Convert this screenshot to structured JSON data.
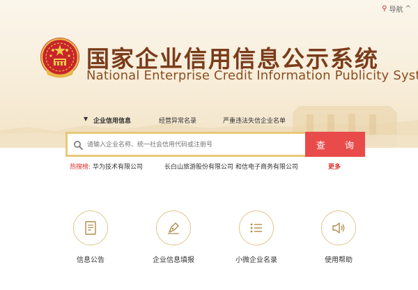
{
  "header": {
    "nav_label": "导航",
    "nav_caret": "^",
    "title_cn": "国家企业信用信息公示系统",
    "title_en": "National Enterprise Credit Information Publicity System"
  },
  "tabs": [
    {
      "label": "企业信用信息",
      "active": true
    },
    {
      "label": "经营异常名录",
      "active": false
    },
    {
      "label": "严重违法失信企业名单",
      "active": false
    }
  ],
  "search": {
    "placeholder": "请输入企业名称、统一社会信用代码或注册号",
    "button_label": "查 询"
  },
  "hot_search": {
    "label": "热搜榜:",
    "items": [
      "华为技术有限公司",
      "长白山旅游股份有限公司",
      "和信电子商务有限公司"
    ],
    "more_label": "更多"
  },
  "features": [
    {
      "label": "信息公告",
      "icon": "document-icon"
    },
    {
      "label": "企业信息填报",
      "icon": "pen-icon"
    },
    {
      "label": "小微企业名录",
      "icon": "list-icon"
    },
    {
      "label": "使用帮助",
      "icon": "speaker-icon"
    }
  ],
  "colors": {
    "accent_red": "#e94b4b",
    "gold_border": "#e8c878",
    "title_brown": "#7a3c1b"
  }
}
